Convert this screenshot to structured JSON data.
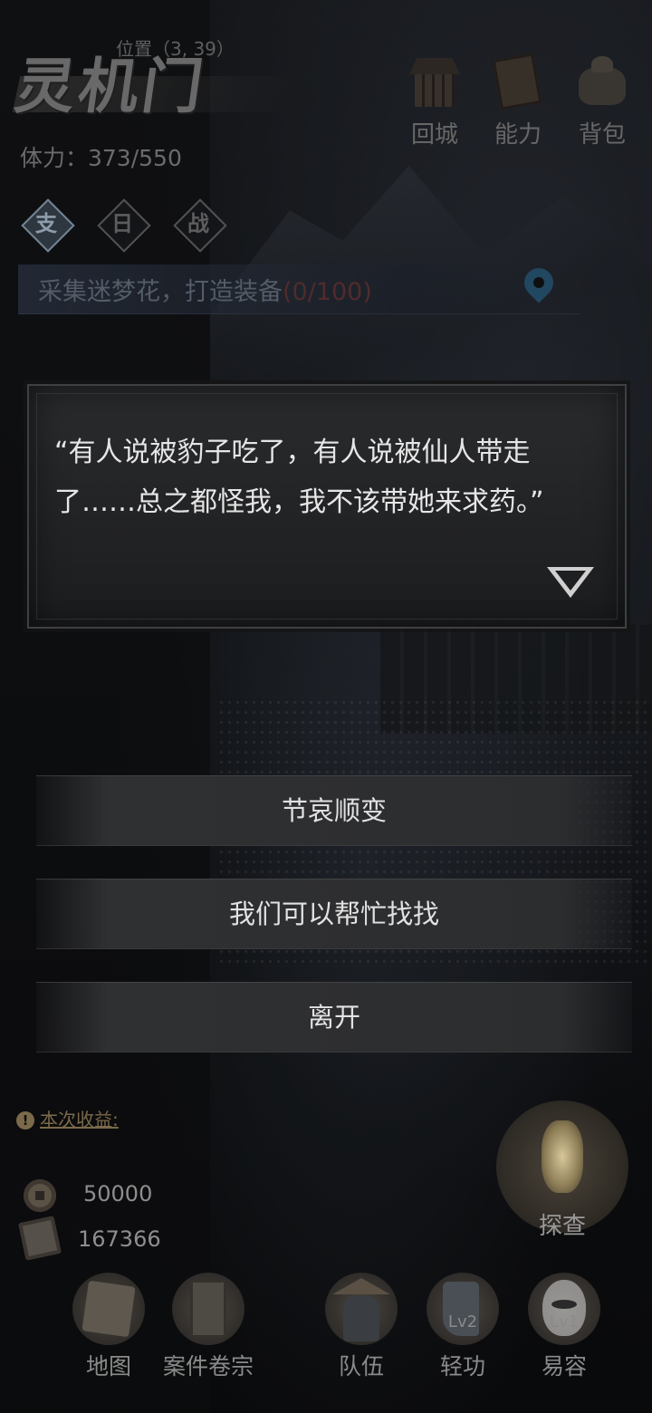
{
  "header": {
    "logo_text": "灵机门",
    "position_label": "位置（3, 39）",
    "stamina_label": "体力：373/550"
  },
  "top_menu": [
    {
      "label": "回城",
      "icon": "city-gate-icon"
    },
    {
      "label": "能力",
      "icon": "skill-book-icon"
    },
    {
      "label": "背包",
      "icon": "bag-icon"
    }
  ],
  "tabs": [
    {
      "label": "支",
      "active": true
    },
    {
      "label": "日",
      "active": false
    },
    {
      "label": "战",
      "active": false
    }
  ],
  "quest": {
    "text": "采集迷梦花，打造装备",
    "progress": "(0/100)"
  },
  "dialog": {
    "text": "“有人说被豹子吃了，有人说被仙人带走了……总之都怪我，我不该带她来求药。”"
  },
  "choices": [
    {
      "label": "节哀顺变"
    },
    {
      "label": "我们可以帮忙找找"
    },
    {
      "label": "离开"
    }
  ],
  "earnings": {
    "title": "本次收益:",
    "coins": "50000",
    "scrolls": "167366"
  },
  "explore": {
    "label": "探查"
  },
  "bottom_nav": [
    {
      "label": "地图",
      "level": ""
    },
    {
      "label": "案件卷宗",
      "level": ""
    },
    {
      "label": "队伍",
      "level": ""
    },
    {
      "label": "轻功",
      "level": "Lv2"
    },
    {
      "label": "易容",
      "level": "Lv1"
    }
  ],
  "colors": {
    "dialog_text": "#e6e6e6",
    "quest_text": "#6f7b8a",
    "quest_progress": "#6a3b3b",
    "pin": "#2e5f80",
    "earnings_title": "#7a6a4a"
  }
}
